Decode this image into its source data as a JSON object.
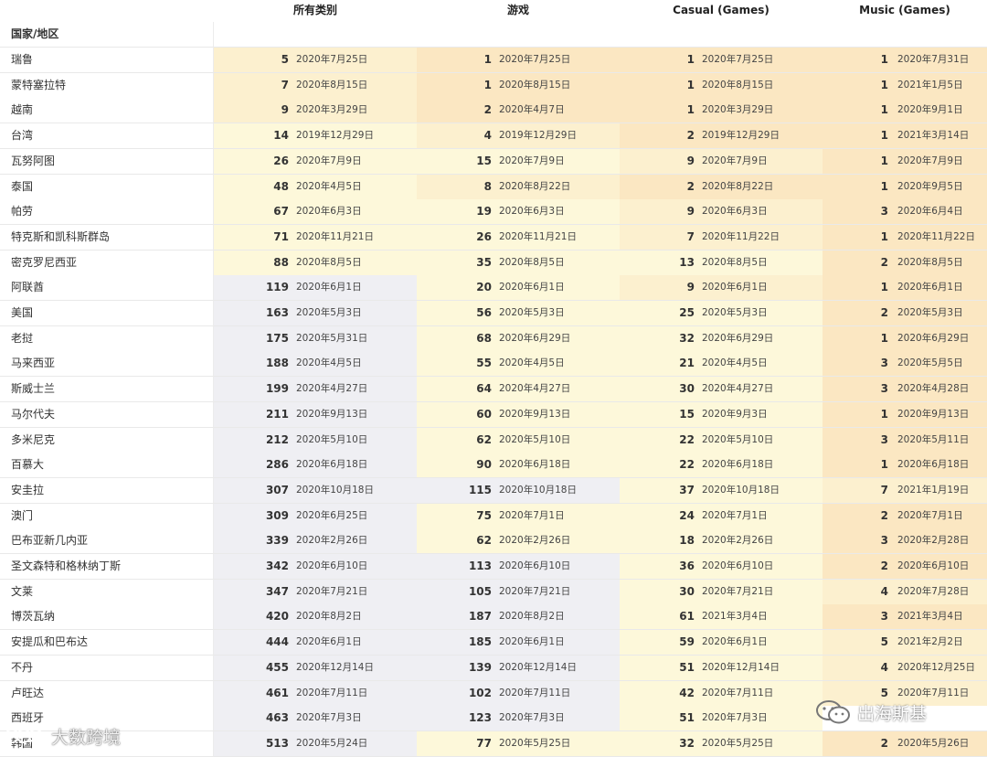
{
  "columns": [
    "所有类别",
    "游戏",
    "Casual (Games)",
    "Music (Games)"
  ],
  "region_header": "国家/地区",
  "colors": {
    "rank_1_3": "#fbe7c2",
    "rank_4_9": "#fcf0cf",
    "rank_10_99": "#fdf8da",
    "rank_100_plus": "#efeff3"
  },
  "rows": [
    {
      "name": "瑞鲁",
      "cells": [
        [
          "5",
          "2020年7月25日"
        ],
        [
          "1",
          "2020年7月25日"
        ],
        [
          "1",
          "2020年7月25日"
        ],
        [
          "1",
          "2020年7月31日"
        ]
      ]
    },
    {
      "name": "蒙特塞拉特",
      "cells": [
        [
          "7",
          "2020年8月15日"
        ],
        [
          "1",
          "2020年8月15日"
        ],
        [
          "1",
          "2020年8月15日"
        ],
        [
          "1",
          "2021年1月5日"
        ]
      ]
    },
    {
      "name": "越南",
      "cells": [
        [
          "9",
          "2020年3月29日"
        ],
        [
          "2",
          "2020年4月7日"
        ],
        [
          "1",
          "2020年3月29日"
        ],
        [
          "1",
          "2020年9月1日"
        ]
      ]
    },
    {
      "name": "台湾",
      "cells": [
        [
          "14",
          "2019年12月29日"
        ],
        [
          "4",
          "2019年12月29日"
        ],
        [
          "2",
          "2019年12月29日"
        ],
        [
          "1",
          "2021年3月14日"
        ]
      ]
    },
    {
      "name": "瓦努阿图",
      "cells": [
        [
          "26",
          "2020年7月9日"
        ],
        [
          "15",
          "2020年7月9日"
        ],
        [
          "9",
          "2020年7月9日"
        ],
        [
          "1",
          "2020年7月9日"
        ]
      ]
    },
    {
      "name": "泰国",
      "cells": [
        [
          "48",
          "2020年4月5日"
        ],
        [
          "8",
          "2020年8月22日"
        ],
        [
          "2",
          "2020年8月22日"
        ],
        [
          "1",
          "2020年9月5日"
        ]
      ]
    },
    {
      "name": "帕劳",
      "cells": [
        [
          "67",
          "2020年6月3日"
        ],
        [
          "19",
          "2020年6月3日"
        ],
        [
          "9",
          "2020年6月3日"
        ],
        [
          "3",
          "2020年6月4日"
        ]
      ]
    },
    {
      "name": "特克斯和凯科斯群岛",
      "cells": [
        [
          "71",
          "2020年11月21日"
        ],
        [
          "26",
          "2020年11月21日"
        ],
        [
          "7",
          "2020年11月22日"
        ],
        [
          "1",
          "2020年11月22日"
        ]
      ]
    },
    {
      "name": "密克罗尼西亚",
      "cells": [
        [
          "88",
          "2020年8月5日"
        ],
        [
          "35",
          "2020年8月5日"
        ],
        [
          "13",
          "2020年8月5日"
        ],
        [
          "2",
          "2020年8月5日"
        ]
      ]
    },
    {
      "name": "阿联酋",
      "cells": [
        [
          "119",
          "2020年6月1日"
        ],
        [
          "20",
          "2020年6月1日"
        ],
        [
          "9",
          "2020年6月1日"
        ],
        [
          "1",
          "2020年6月1日"
        ]
      ]
    },
    {
      "name": "美国",
      "cells": [
        [
          "163",
          "2020年5月3日"
        ],
        [
          "56",
          "2020年5月3日"
        ],
        [
          "25",
          "2020年5月3日"
        ],
        [
          "2",
          "2020年5月3日"
        ]
      ]
    },
    {
      "name": "老挝",
      "cells": [
        [
          "175",
          "2020年5月31日"
        ],
        [
          "68",
          "2020年6月29日"
        ],
        [
          "32",
          "2020年6月29日"
        ],
        [
          "1",
          "2020年6月29日"
        ]
      ]
    },
    {
      "name": "马来西亚",
      "cells": [
        [
          "188",
          "2020年4月5日"
        ],
        [
          "55",
          "2020年4月5日"
        ],
        [
          "21",
          "2020年4月5日"
        ],
        [
          "3",
          "2020年5月5日"
        ]
      ]
    },
    {
      "name": "斯威士兰",
      "cells": [
        [
          "199",
          "2020年4月27日"
        ],
        [
          "64",
          "2020年4月27日"
        ],
        [
          "30",
          "2020年4月27日"
        ],
        [
          "3",
          "2020年4月28日"
        ]
      ]
    },
    {
      "name": "马尔代夫",
      "cells": [
        [
          "211",
          "2020年9月13日"
        ],
        [
          "60",
          "2020年9月13日"
        ],
        [
          "15",
          "2020年9月3日"
        ],
        [
          "1",
          "2020年9月13日"
        ]
      ]
    },
    {
      "name": "多米尼克",
      "cells": [
        [
          "212",
          "2020年5月10日"
        ],
        [
          "62",
          "2020年5月10日"
        ],
        [
          "22",
          "2020年5月10日"
        ],
        [
          "3",
          "2020年5月11日"
        ]
      ]
    },
    {
      "name": "百慕大",
      "cells": [
        [
          "286",
          "2020年6月18日"
        ],
        [
          "90",
          "2020年6月18日"
        ],
        [
          "22",
          "2020年6月18日"
        ],
        [
          "1",
          "2020年6月18日"
        ]
      ]
    },
    {
      "name": "安圭拉",
      "cells": [
        [
          "307",
          "2020年10月18日"
        ],
        [
          "115",
          "2020年10月18日"
        ],
        [
          "37",
          "2020年10月18日"
        ],
        [
          "7",
          "2021年1月19日"
        ]
      ]
    },
    {
      "name": "澳门",
      "cells": [
        [
          "309",
          "2020年6月25日"
        ],
        [
          "75",
          "2020年7月1日"
        ],
        [
          "24",
          "2020年7月1日"
        ],
        [
          "2",
          "2020年7月1日"
        ]
      ]
    },
    {
      "name": "巴布亚新几内亚",
      "cells": [
        [
          "339",
          "2020年2月26日"
        ],
        [
          "62",
          "2020年2月26日"
        ],
        [
          "18",
          "2020年2月26日"
        ],
        [
          "3",
          "2020年2月28日"
        ]
      ]
    },
    {
      "name": "圣文森特和格林纳丁斯",
      "cells": [
        [
          "342",
          "2020年6月10日"
        ],
        [
          "113",
          "2020年6月10日"
        ],
        [
          "36",
          "2020年6月10日"
        ],
        [
          "2",
          "2020年6月10日"
        ]
      ]
    },
    {
      "name": "文莱",
      "cells": [
        [
          "347",
          "2020年7月21日"
        ],
        [
          "105",
          "2020年7月21日"
        ],
        [
          "30",
          "2020年7月21日"
        ],
        [
          "4",
          "2020年7月28日"
        ]
      ]
    },
    {
      "name": "博茨瓦纳",
      "cells": [
        [
          "420",
          "2020年8月2日"
        ],
        [
          "187",
          "2020年8月2日"
        ],
        [
          "61",
          "2021年3月4日"
        ],
        [
          "3",
          "2021年3月4日"
        ]
      ]
    },
    {
      "name": "安提瓜和巴布达",
      "cells": [
        [
          "444",
          "2020年6月1日"
        ],
        [
          "185",
          "2020年6月1日"
        ],
        [
          "59",
          "2020年6月1日"
        ],
        [
          "5",
          "2021年2月2日"
        ]
      ]
    },
    {
      "name": "不丹",
      "cells": [
        [
          "455",
          "2020年12月14日"
        ],
        [
          "139",
          "2020年12月14日"
        ],
        [
          "51",
          "2020年12月14日"
        ],
        [
          "4",
          "2020年12月25日"
        ]
      ]
    },
    {
      "name": "卢旺达",
      "cells": [
        [
          "461",
          "2020年7月11日"
        ],
        [
          "102",
          "2020年7月11日"
        ],
        [
          "42",
          "2020年7月11日"
        ],
        [
          "5",
          "2020年7月11日"
        ]
      ]
    },
    {
      "name": "西班牙",
      "cells": [
        [
          "463",
          "2020年7月3日"
        ],
        [
          "123",
          "2020年7月3日"
        ],
        [
          "51",
          "2020年7月3日"
        ],
        [
          "",
          ""
        ]
      ]
    },
    {
      "name": "韩国",
      "cells": [
        [
          "513",
          "2020年5月24日"
        ],
        [
          "77",
          "2020年5月25日"
        ],
        [
          "32",
          "2020年5月25日"
        ],
        [
          "2",
          "2020年5月26日"
        ]
      ]
    }
  ],
  "watermarks": {
    "left": "大数跨境",
    "right": "出海斯基"
  }
}
